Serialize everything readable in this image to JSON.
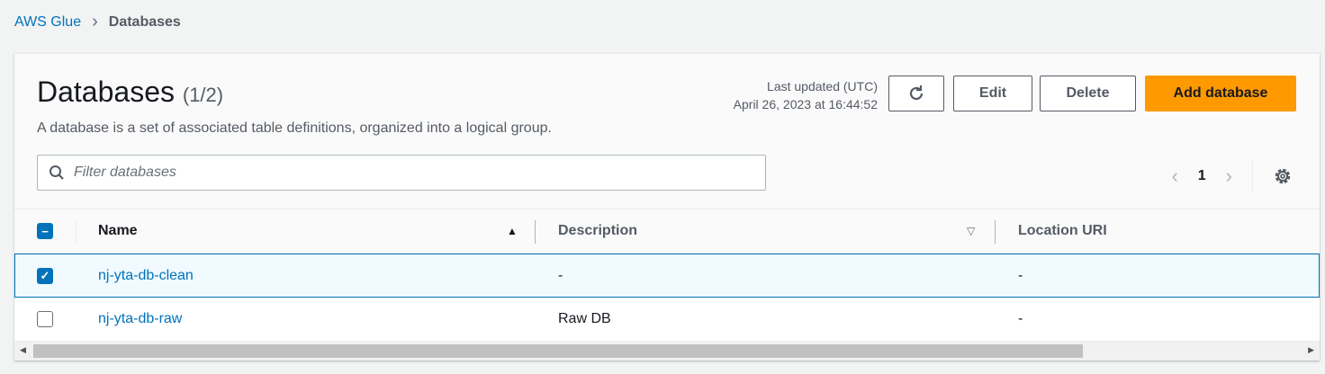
{
  "breadcrumb": {
    "parent": "AWS Glue",
    "current": "Databases"
  },
  "header": {
    "title": "Databases",
    "count": "(1/2)",
    "description": "A database is a set of associated table definitions, organized into a logical group.",
    "last_updated_label": "Last updated (UTC)",
    "last_updated_value": "April 26, 2023 at 16:44:52"
  },
  "buttons": {
    "edit": "Edit",
    "delete": "Delete",
    "add": "Add database"
  },
  "filter": {
    "placeholder": "Filter databases",
    "value": ""
  },
  "pagination": {
    "page": "1"
  },
  "table": {
    "columns": [
      "Name",
      "Description",
      "Location URI"
    ],
    "sort": "Name ascending",
    "rows": [
      {
        "name": "nj-yta-db-clean",
        "description": "-",
        "location": "-",
        "selected": true
      },
      {
        "name": "nj-yta-db-raw",
        "description": "Raw DB",
        "location": "-",
        "selected": false
      }
    ]
  },
  "colors": {
    "accent": "#0073bb",
    "primary": "#ff9900"
  }
}
